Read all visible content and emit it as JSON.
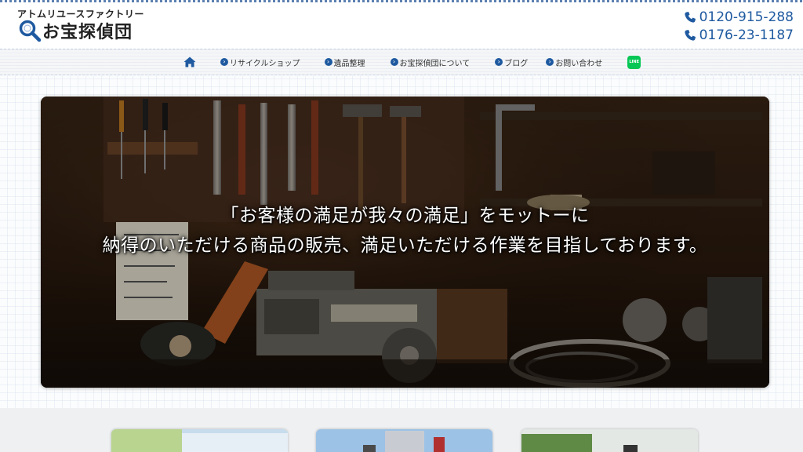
{
  "brand": {
    "subtitle": "アトムリユースファクトリー",
    "name": "お宝探偵団"
  },
  "phones": [
    "0120-915-288",
    "0176-23-1187"
  ],
  "nav": {
    "items": [
      {
        "label": "リサイクルショップ"
      },
      {
        "label": "遺品整理"
      },
      {
        "label": "お宝探偵団について"
      },
      {
        "label": "ブログ"
      },
      {
        "label": "お問い合わせ"
      }
    ],
    "line_label": "LINE"
  },
  "hero": {
    "line1": "「お客様の満足が我々の満足」をモットーに",
    "line2": "納得のいただける商品の販売、満足いただける作業を目指しております。"
  },
  "colors": {
    "accent": "#1f5aa0",
    "line_green": "#06c755"
  },
  "icons": {
    "home": "home-icon",
    "phone": "phone-icon",
    "nav_bullet": "chevron-circle-right-icon",
    "logo": "magnifier-icon",
    "line": "line-app-icon"
  }
}
